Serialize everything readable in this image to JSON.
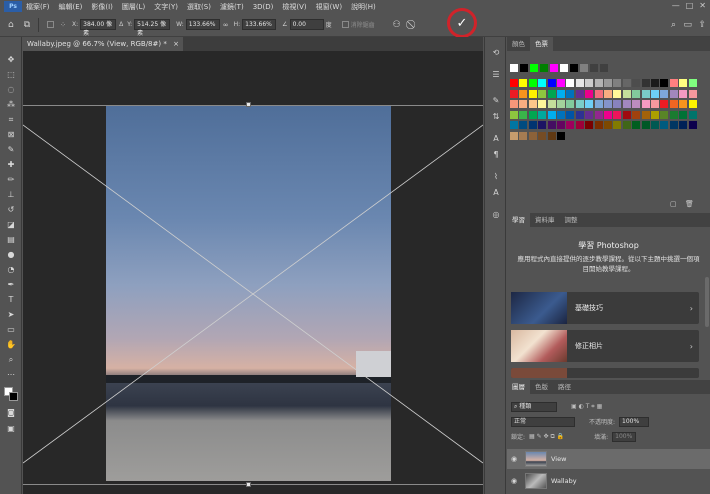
{
  "app": {
    "logo": "Ps"
  },
  "menu": [
    "檔案(F)",
    "編輯(E)",
    "影像(I)",
    "圖層(L)",
    "文字(Y)",
    "選取(S)",
    "濾鏡(T)",
    "3D(D)",
    "檢視(V)",
    "視窗(W)",
    "說明(H)"
  ],
  "window_controls": {
    "minimize": "—",
    "maximize": "□",
    "close": "✕"
  },
  "options": {
    "x_label": "X:",
    "x_value": "384.00 像素",
    "y_label": "Y:",
    "y_value": "514.25 像素",
    "w_label": "W:",
    "w_value": "133.66%",
    "h_label": "H:",
    "h_value": "133.66%",
    "angle_value": "0.00",
    "angle_unit": "度",
    "interp_label": "消除鋸齒",
    "commit_glyph": "✓",
    "cancel_glyph": "⃠"
  },
  "document": {
    "tab_title": "Wallaby.jpeg @ 66.7% (View, RGB/8#) *",
    "close_glyph": "×"
  },
  "swatches_panel": {
    "tabs": [
      "顏色",
      "色票"
    ],
    "active_tab": 1,
    "recent": [
      "#ffffff",
      "#000000",
      "#00ff00",
      "#008000",
      "#ff00ff",
      "#ffffff",
      "#000000",
      "#808080",
      "#404040",
      "#404040"
    ],
    "rows": [
      [
        "#ff0000",
        "#ffff00",
        "#00ff00",
        "#00ffff",
        "#0000ff",
        "#ff00ff",
        "#ffffff",
        "#e6e6e6",
        "#cccccc",
        "#b3b3b3",
        "#999999",
        "#808080",
        "#666666",
        "#4d4d4d",
        "#333333",
        "#1a1a1a",
        "#000000",
        "#ff8080",
        "#ffff80",
        "#80ff80"
      ],
      [
        "#ed1c24",
        "#f7941d",
        "#fff200",
        "#8dc63f",
        "#00a651",
        "#00aeef",
        "#0072bc",
        "#662d91",
        "#ec008c",
        "#f26d7d",
        "#f9ad81",
        "#fff799",
        "#c4df9b",
        "#82ca9c",
        "#7accc8",
        "#6dcff6",
        "#7da7d9",
        "#a187be",
        "#f49ac2",
        "#f6989d"
      ],
      [
        "#f7977a",
        "#f9ad81",
        "#fdc68a",
        "#fff79a",
        "#c4df9b",
        "#a3d39c",
        "#82ca9d",
        "#7bcdc8",
        "#6ecff6",
        "#7ea7d8",
        "#8493ca",
        "#8882be",
        "#a187be",
        "#bc8dbf",
        "#f49ac2",
        "#f6989d",
        "#ed1c24",
        "#f26522",
        "#f7941d",
        "#fff200"
      ],
      [
        "#8dc63f",
        "#39b54a",
        "#00a651",
        "#00a99d",
        "#00aeef",
        "#0072bc",
        "#0054a6",
        "#2e3192",
        "#662d91",
        "#92278f",
        "#ec008c",
        "#ed145b",
        "#9e0b0f",
        "#a0410d",
        "#a36209",
        "#aba000",
        "#598527",
        "#1a7b30",
        "#007236",
        "#00746b"
      ],
      [
        "#0076a3",
        "#004b80",
        "#003471",
        "#1b1464",
        "#440e62",
        "#630460",
        "#9e005d",
        "#9e0039",
        "#790000",
        "#7b2e00",
        "#7d4900",
        "#827b00",
        "#406618",
        "#005e20",
        "#005826",
        "#005952",
        "#005b7f",
        "#003663",
        "#002157",
        "#0d004c"
      ],
      [
        "#c69c6d",
        "#a67c52",
        "#8c6239",
        "#754c24",
        "#603913",
        "#000000"
      ]
    ]
  },
  "learn_panel": {
    "tabs": [
      "學習",
      "資料庫",
      "調整"
    ],
    "active_tab": 0,
    "title": "學習 Photoshop",
    "description": "應用程式內直接提供的逐步教學課程。從以下主題中挑選一個項目開始教學課程。",
    "cards": [
      {
        "label": "基礎技巧",
        "arrow": "›"
      },
      {
        "label": "修正相片",
        "arrow": "›"
      },
      {
        "label": "",
        "arrow": ""
      }
    ]
  },
  "layers_panel": {
    "tabs": [
      "圖層",
      "色版",
      "路徑"
    ],
    "active_tab": 0,
    "filter_label": "種類",
    "blend_mode": "正常",
    "opacity_label": "不透明度:",
    "opacity_value": "100%",
    "lock_label": "鎖定:",
    "fill_label": "填滿:",
    "fill_value": "100%",
    "layers": [
      {
        "name": "View",
        "visible": true,
        "selected": true
      },
      {
        "name": "Wallaby",
        "visible": true,
        "selected": false
      }
    ]
  }
}
